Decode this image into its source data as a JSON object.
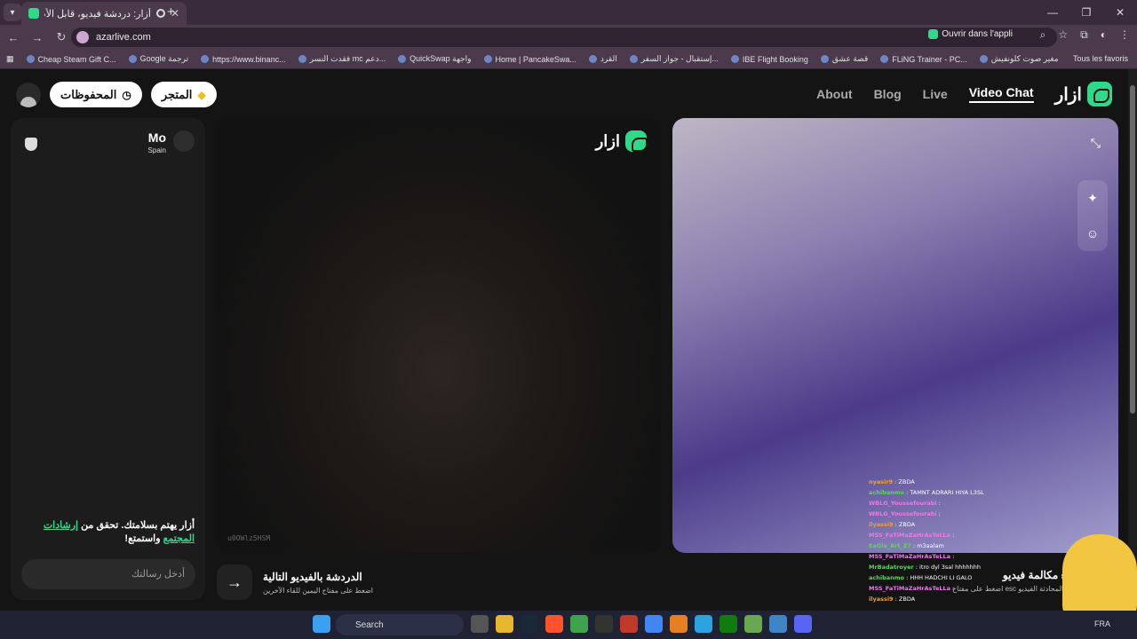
{
  "browser": {
    "tab_title": "أزار: دردشة فيديو، قابل الأصد...",
    "url": "azarlive.com",
    "open_in_app": "Ouvrir dans l'appli",
    "bookmarks": [
      "Cheap Steam Gift C...",
      "Google ترجمة",
      "https://www.binanc...",
      "فقدت النسر mc دعم...",
      "QuickSwap واجهة",
      "Home | PancakeSwa...",
      "القرد",
      "إستقبال - جواز السفر...",
      "IBE Flight Booking",
      "قصة عشق",
      "FLiNG Trainer - PC...",
      "مغير صوت كلونفيش"
    ],
    "all_bookmarks": "Tous les favoris"
  },
  "nav": {
    "about": "About",
    "blog": "Blog",
    "live": "Live",
    "video_chat": "Video Chat",
    "brand": "ازار"
  },
  "header": {
    "shop": "المتجر",
    "saved": "المحفوظات"
  },
  "peer": {
    "name": "Mo",
    "country": "Spain"
  },
  "chat": {
    "safety_prefix": "أزار يهتم بسلامتك. تحقق من",
    "safety_link": "إرشادات المجتمع",
    "safety_suffix": "واستمتع!",
    "input_placeholder": "أدخل رسالتك"
  },
  "video": {
    "watermark": "ازار",
    "session_id": "u0OWlz5HSM"
  },
  "next_chat": {
    "title": "الدردشة بالفيديو التالية",
    "hint": "اضغط على مفتاح اليمين للقاء الآخرين"
  },
  "end_call": {
    "title": "إنهاء مكالمة فيديو",
    "hint": "اضغط على مفتاح esc لإنهاء المحادثة الفيديو"
  },
  "stream_chat": [
    {
      "user": "nyasir9",
      "text": "ZBDA"
    },
    {
      "user": "achibanmo",
      "text": "TAMNT ADRARI HIYA L3SL"
    },
    {
      "user": "WBLG_Youssefourabi",
      "text": ""
    },
    {
      "user": "WBLG_Youssefourabi",
      "text": ""
    },
    {
      "user": "ilyassi9",
      "text": "ZBDA"
    },
    {
      "user": "MSS_FaTiMaZaHrAsTeLLa",
      "text": ""
    },
    {
      "user": "EaGle_Art_Z7",
      "text": "m3aalam"
    },
    {
      "user": "MSS_FaTiMaZaHrAsTeLLa",
      "text": ""
    },
    {
      "user": "MrBadatroyer",
      "text": "itro dyl 3sal hhhhhhh"
    },
    {
      "user": "achibanmo",
      "text": "HHH HADCHI LI GALO"
    },
    {
      "user": "MSS_FaTiMaZaHrAsTeLLa",
      "text": ""
    },
    {
      "user": "ilyassi9",
      "text": "ZBDA"
    }
  ],
  "taskbar": {
    "search": "Search",
    "lang": "FRA"
  },
  "colors": {
    "accent": "#2fd98a",
    "background": "#141414"
  }
}
